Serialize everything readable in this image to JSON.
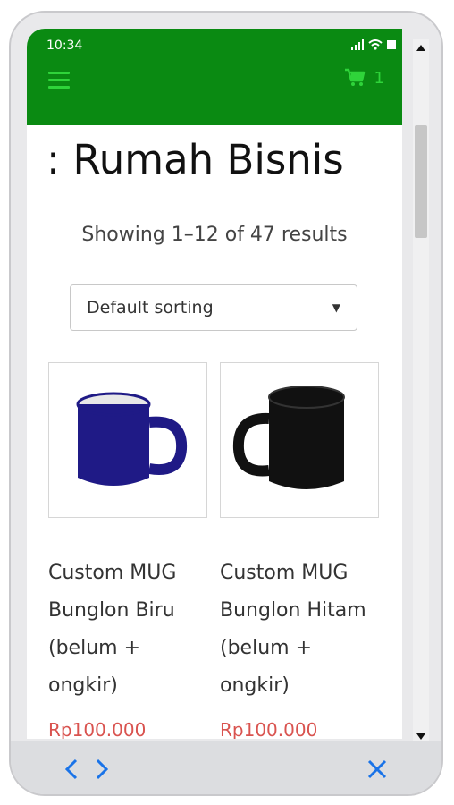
{
  "status_bar": {
    "time": "10:34"
  },
  "header": {
    "cart_count": "1"
  },
  "page": {
    "title": ": Rumah Bisnis",
    "result_count": "Showing 1–12 of 47 results"
  },
  "sorting": {
    "selected": "Default sorting"
  },
  "products": [
    {
      "name": "Custom MUG Bunglon Biru (belum + ongkir)",
      "price": "Rp100.000",
      "mug_color": "#1f1a86"
    },
    {
      "name": "Custom MUG Bunglon Hitam (belum + ongkir)",
      "price": "Rp100.000",
      "mug_color": "#111111"
    }
  ],
  "colors": {
    "appbar": "#0a8a12",
    "accent_green": "#2fd43a",
    "price_red": "#d9534f",
    "nav_blue": "#1a73e8"
  },
  "icons": {
    "menu": "hamburger-icon",
    "cart": "cart-icon",
    "back": "chevron-left-icon",
    "forward": "chevron-right-icon",
    "close": "close-icon"
  }
}
